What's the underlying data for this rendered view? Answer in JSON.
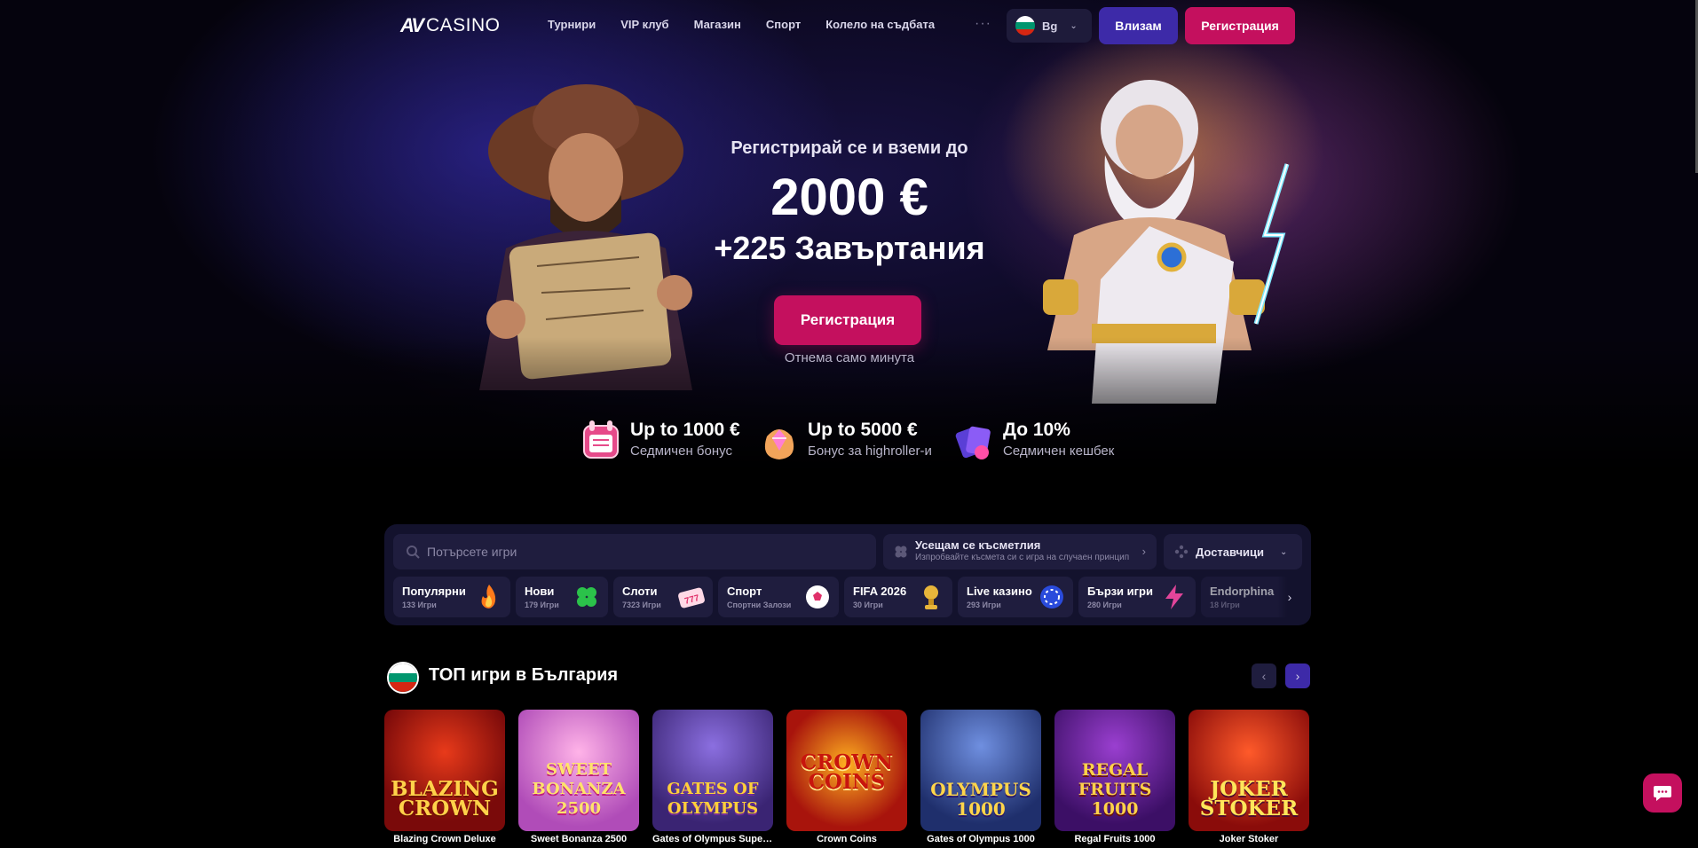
{
  "nav": {
    "logo_mark": "AV",
    "logo_text": "CASINO",
    "links": [
      "Турнири",
      "VIP клуб",
      "Магазин",
      "Спорт",
      "Колело на съдбата"
    ],
    "more": "···",
    "language": "Bg",
    "login": "Влизам",
    "register": "Регистрация"
  },
  "hero": {
    "subtitle": "Регистрирай се и вземи до",
    "amount": "2000 €",
    "spins": "+225 Завъртания",
    "cta": "Регистрация",
    "note": "Отнема само минута"
  },
  "bonuses": [
    {
      "title": "Up to 1000 €",
      "desc": "Седмичен бонус",
      "icon": "calendar-gift-icon"
    },
    {
      "title": "Up to 5000 €",
      "desc": "Бонус за highroller-и",
      "icon": "diamond-bag-icon"
    },
    {
      "title": "До 10%",
      "desc": "Седмичен кешбек",
      "icon": "cashback-cards-icon"
    }
  ],
  "search": {
    "placeholder": "Потърсете игри",
    "lucky_title": "Усещам се късметлия",
    "lucky_sub": "Изпробвайте късмета си с игра на случаен принцип",
    "providers": "Доставчици"
  },
  "categories": [
    {
      "label": "Популярни",
      "count": "133 Игри",
      "icon": "flame-icon"
    },
    {
      "label": "Нови",
      "count": "179 Игри",
      "icon": "clover-icon"
    },
    {
      "label": "Слоти",
      "count": "7323 Игри",
      "icon": "slot-reels-icon"
    },
    {
      "label": "Спорт",
      "count": "Спортни Залози",
      "icon": "soccer-ball-icon"
    },
    {
      "label": "FIFA 2026",
      "count": "30 Игри",
      "icon": "trophy-icon"
    },
    {
      "label": "Live казино",
      "count": "293 Игри",
      "icon": "poker-chip-icon"
    },
    {
      "label": "Бързи игри",
      "count": "280 Игри",
      "icon": "lightning-icon"
    },
    {
      "label": "Endorphina",
      "count": "18 Игри",
      "icon": "provider-icon"
    }
  ],
  "top_games": {
    "title": "ТОП игри в България",
    "games": [
      {
        "name": "Blazing Crown Deluxe",
        "art": "Blazing Crown",
        "bg": "#7a0a0a",
        "fg": "#ffd24a"
      },
      {
        "name": "Sweet Bonanza 2500",
        "art": "Sweet Bonanza 2500",
        "bg": "#d76fcf",
        "fg": "#ffe36b"
      },
      {
        "name": "Gates of Olympus Super...",
        "art": "Gates of Olympus",
        "bg": "#5a3fa6",
        "fg": "#ffcf3a"
      },
      {
        "name": "Crown Coins",
        "art": "Crown Coins",
        "bg": "#a8140c",
        "fg": "#ffce3c"
      },
      {
        "name": "Gates of Olympus 1000",
        "art": "Olympus 1000",
        "bg": "#2b3f86",
        "fg": "#ffd54a"
      },
      {
        "name": "Regal Fruits 1000",
        "art": "Regal Fruits 1000",
        "bg": "#5c1a8f",
        "fg": "#ffd24a"
      },
      {
        "name": "Joker Stoker",
        "art": "Joker Stoker",
        "bg": "#b0140f",
        "fg": "#ffe65a"
      }
    ]
  },
  "colors": {
    "accent": "#c4105e",
    "secondary": "#3d2aa8",
    "panel": "#13122d"
  }
}
